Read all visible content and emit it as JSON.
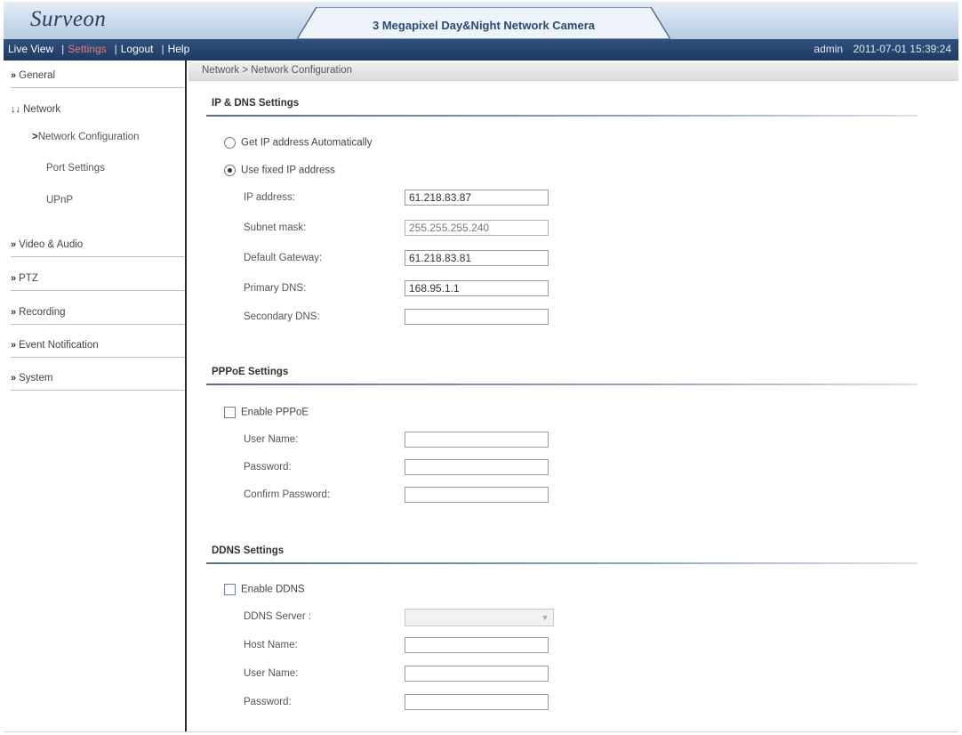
{
  "header": {
    "logo": "Surveon",
    "title": "3 Megapixel Day&Night Network Camera"
  },
  "nav": {
    "live_view": "Live View",
    "settings": "Settings",
    "logout": "Logout",
    "help": "Help",
    "user": "admin",
    "datetime": "2011-07-01 15:39:24"
  },
  "sidebar": {
    "general": "General",
    "network": "Network",
    "network_sub": [
      "Network Configuration",
      "Port Settings",
      "UPnP"
    ],
    "video_audio": "Video & Audio",
    "ptz": "PTZ",
    "recording": "Recording",
    "event_notification": "Event Notification",
    "system": "System"
  },
  "breadcrumb": "Network > Network Configuration",
  "ip_dns": {
    "title": "IP & DNS Settings",
    "auto_label": "Get IP address Automatically",
    "fixed_label": "Use fixed IP address",
    "selected": "fixed",
    "fields": {
      "ip_label": "IP address:",
      "ip_value": "61.218.83.87",
      "subnet_label": "Subnet mask:",
      "subnet_value": "255.255.255.240",
      "gateway_label": "Default Gateway:",
      "gateway_value": "61.218.83.81",
      "dns1_label": "Primary DNS:",
      "dns1_value": "168.95.1.1",
      "dns2_label": "Secondary DNS:",
      "dns2_value": ""
    }
  },
  "pppoe": {
    "title": "PPPoE Settings",
    "enable_label": "Enable PPPoE",
    "enabled": false,
    "user_label": "User Name:",
    "password_label": "Password:",
    "confirm_label": "Confirm Password:"
  },
  "ddns": {
    "title": "DDNS Settings",
    "enable_label": "Enable DDNS",
    "enabled": false,
    "server_label": "DDNS Server :",
    "server_value": "",
    "host_label": "Host Name:",
    "user_label": "User Name:",
    "password_label": "Password:"
  },
  "colors": {
    "nav_bg": "#1e3a5f",
    "active_link": "#e87a7a",
    "header_title": "#2a4a74"
  }
}
